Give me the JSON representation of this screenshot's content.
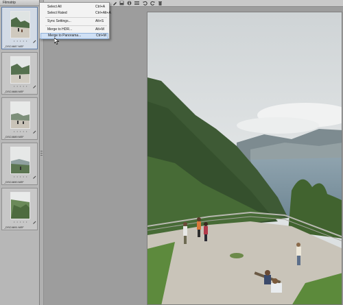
{
  "filmstrip": {
    "title": "Filmstrip",
    "items": [
      {
        "name": "_DSC4687.NEF",
        "stars": "• • • • •",
        "selected": true
      },
      {
        "name": "_DSC4688.NEF",
        "stars": "• • • • •",
        "selected": false
      },
      {
        "name": "_DSC4689.NEF",
        "stars": "• • • • •",
        "selected": false
      },
      {
        "name": "_DSC4690.NEF",
        "stars": "• • • • •",
        "selected": false
      },
      {
        "name": "_DSC4691.NEF",
        "stars": "• • • • •",
        "selected": false
      }
    ]
  },
  "toolbar": {
    "icons": [
      "brush-icon",
      "save-icon",
      "info-icon",
      "list-icon",
      "rotate-left-icon",
      "rotate-right-icon",
      "trash-icon"
    ]
  },
  "menu": {
    "items": [
      {
        "label": "Select All",
        "shortcut": "Ctrl+A"
      },
      {
        "label": "Select Rated",
        "shortcut": "Ctrl+Alt+A"
      },
      {
        "label": "Sync Settings...",
        "shortcut": "Alt+S"
      },
      {
        "label": "Merge to HDR...",
        "shortcut": "Alt+M"
      },
      {
        "label": "Merge to Panorama...",
        "shortcut": "Ctrl+M"
      }
    ]
  },
  "colors": {
    "menu_hover": "#cfe0f5",
    "selection_border": "#5b7aa6"
  }
}
